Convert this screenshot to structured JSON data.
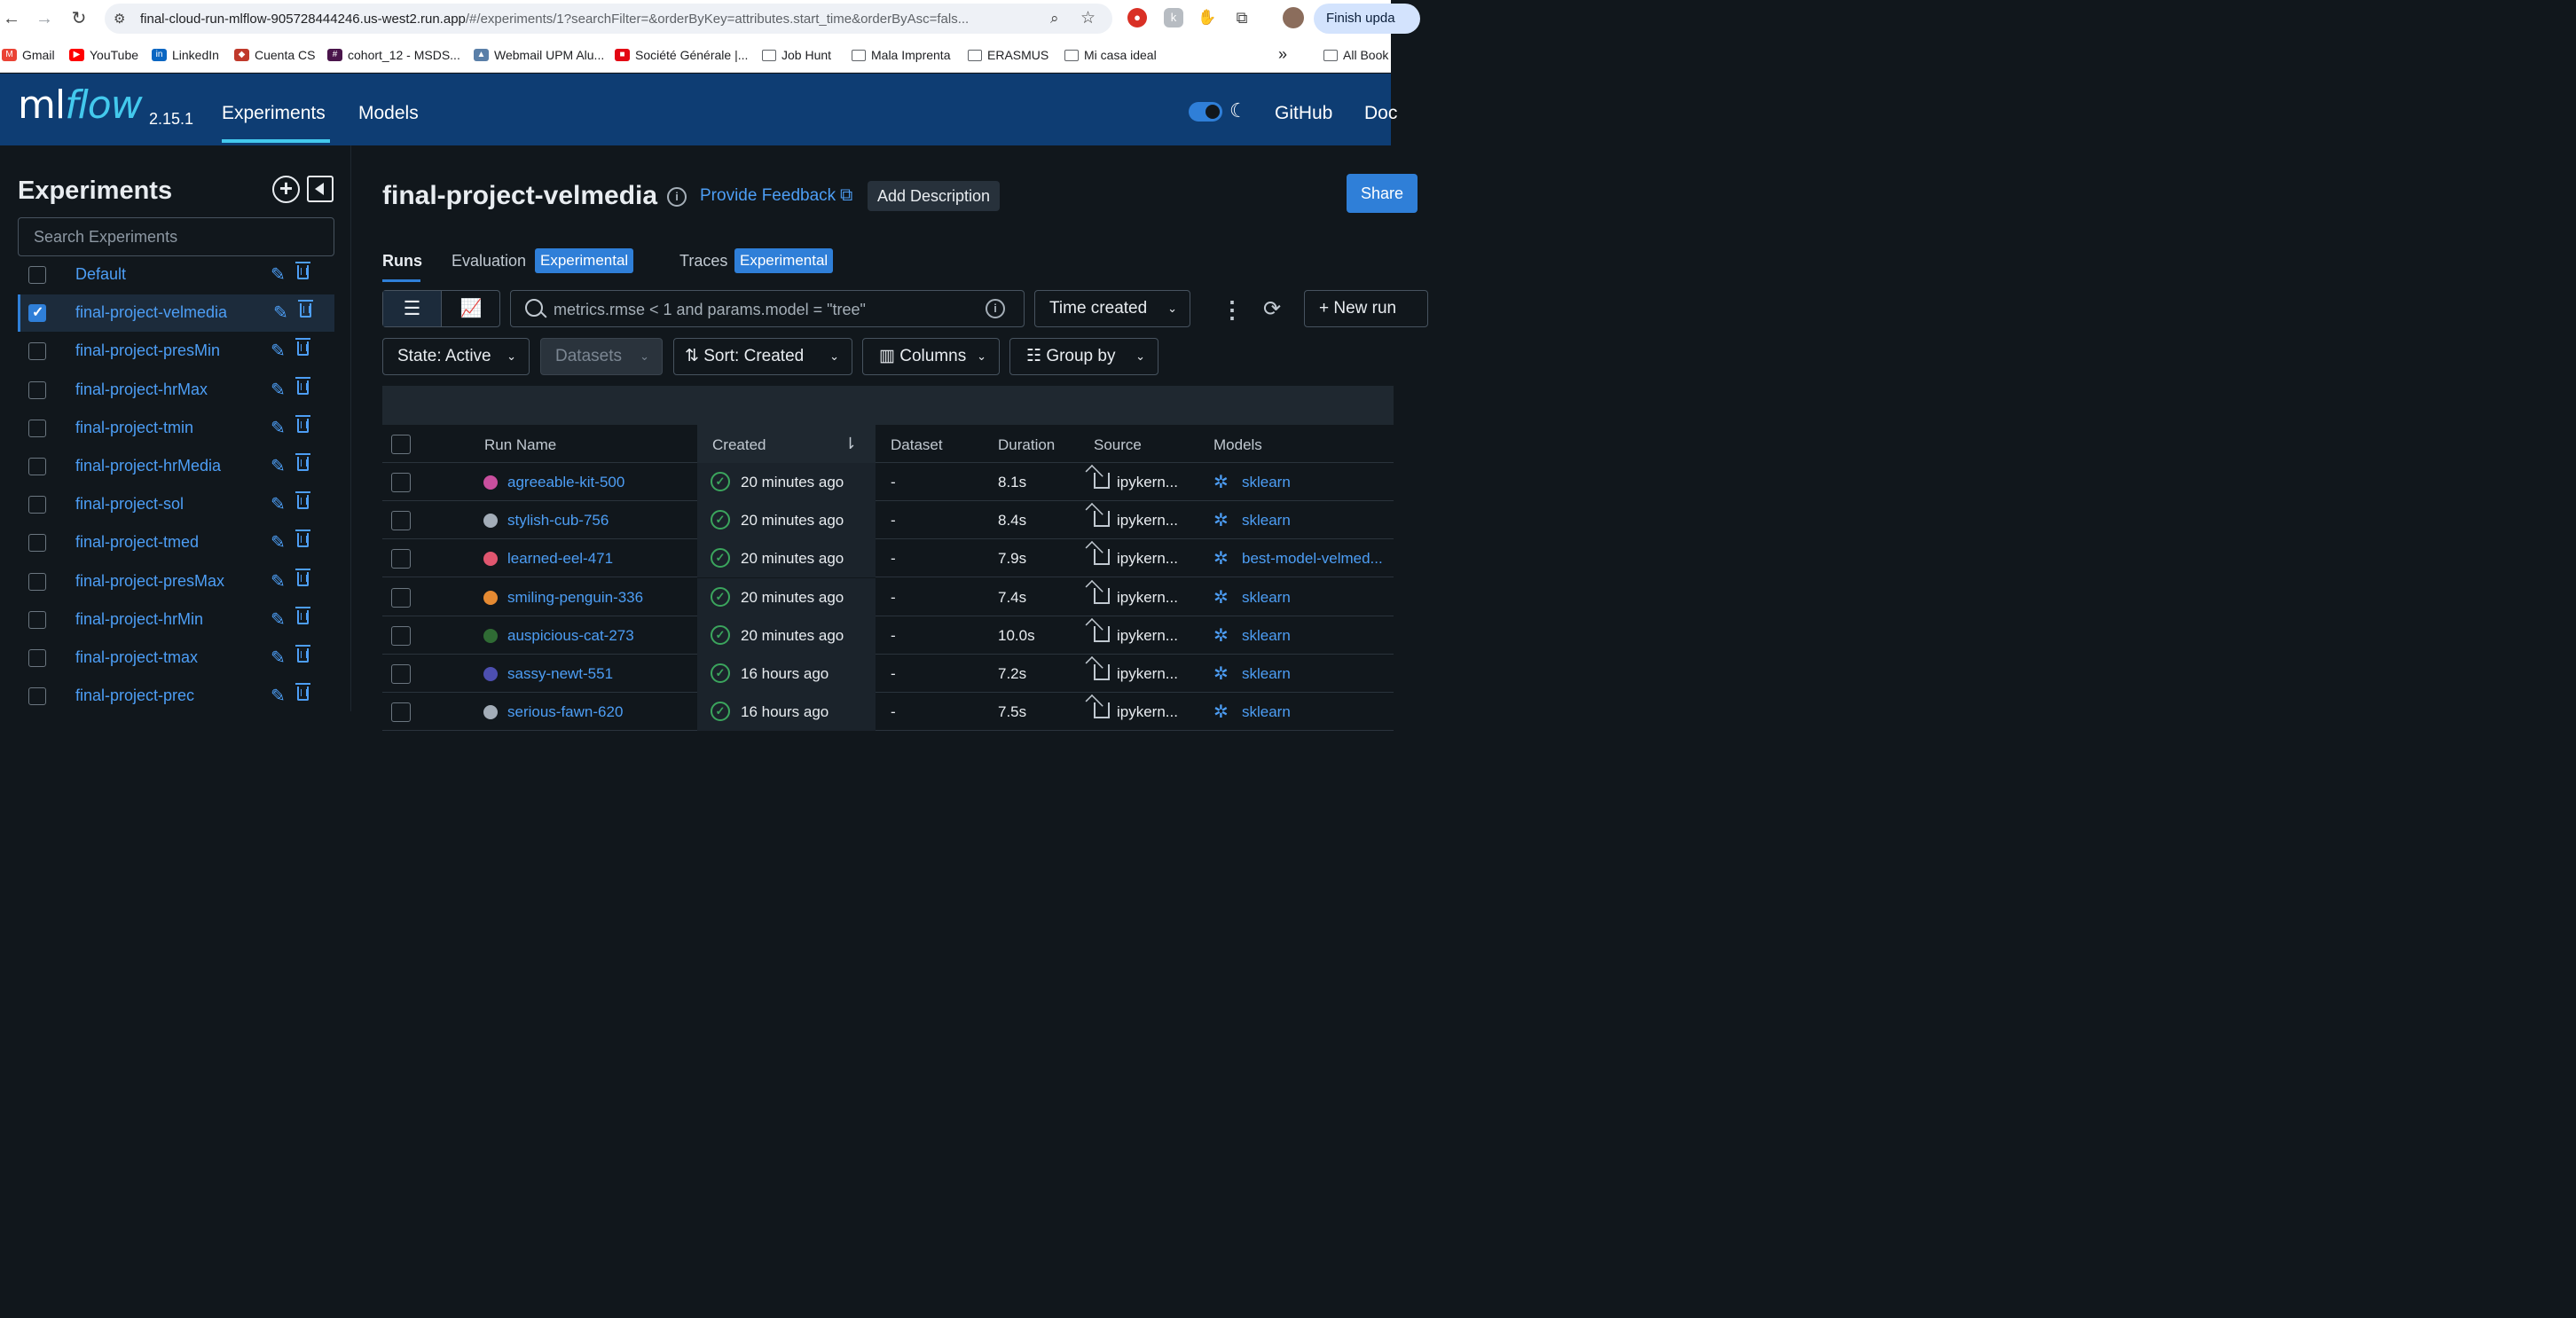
{
  "browser": {
    "url_main": "final-cloud-run-mlflow-905728444246.us-west2.run.app",
    "url_rest": "/#/experiments/1?searchFilter=&orderByKey=attributes.start_time&orderByAsc=fals...",
    "finish_update": "Finish upda",
    "bookmarks": [
      "Gmail",
      "YouTube",
      "LinkedIn",
      "Cuenta CS",
      "cohort_12 - MSDS...",
      "Webmail UPM Alu...",
      "Société Générale |...",
      "Job Hunt",
      "Mala Imprenta",
      "ERASMUS",
      "Mi casa ideal",
      "All Book"
    ],
    "overflow": "»"
  },
  "header": {
    "logo_ml": "ml",
    "logo_flow": "flow",
    "version": "2.15.1",
    "nav": [
      "Experiments",
      "Models"
    ],
    "github": "GitHub",
    "docs": "Doc"
  },
  "sidebar": {
    "title": "Experiments",
    "search_placeholder": "Search Experiments",
    "experiments": [
      {
        "name": "Default",
        "selected": false
      },
      {
        "name": "final-project-velmedia",
        "selected": true
      },
      {
        "name": "final-project-presMin",
        "selected": false
      },
      {
        "name": "final-project-hrMax",
        "selected": false
      },
      {
        "name": "final-project-tmin",
        "selected": false
      },
      {
        "name": "final-project-hrMedia",
        "selected": false
      },
      {
        "name": "final-project-sol",
        "selected": false
      },
      {
        "name": "final-project-tmed",
        "selected": false
      },
      {
        "name": "final-project-presMax",
        "selected": false
      },
      {
        "name": "final-project-hrMin",
        "selected": false
      },
      {
        "name": "final-project-tmax",
        "selected": false
      },
      {
        "name": "final-project-prec",
        "selected": false
      }
    ]
  },
  "main": {
    "title": "final-project-velmedia",
    "feedback": "Provide Feedback",
    "add_description": "Add Description",
    "share": "Share",
    "tabs": [
      {
        "label": "Runs",
        "badge": ""
      },
      {
        "label": "Evaluation",
        "badge": "Experimental"
      },
      {
        "label": "Traces",
        "badge": "Experimental"
      }
    ],
    "search_placeholder": "metrics.rmse < 1 and params.model = \"tree\"",
    "time_created": "Time created",
    "new_run": "New run",
    "filters": {
      "state": "State: Active",
      "datasets": "Datasets",
      "sort": "Sort: Created",
      "columns": "Columns",
      "group_by": "Group by"
    },
    "columns": [
      "Run Name",
      "Created",
      "Dataset",
      "Duration",
      "Source",
      "Models"
    ],
    "rows": [
      {
        "name": "agreeable-kit-500",
        "color": "#c94f9e",
        "created": "20 minutes ago",
        "dataset": "-",
        "duration": "8.1s",
        "source": "ipykern...",
        "model": "sklearn"
      },
      {
        "name": "stylish-cub-756",
        "color": "#a3adb8",
        "created": "20 minutes ago",
        "dataset": "-",
        "duration": "8.4s",
        "source": "ipykern...",
        "model": "sklearn"
      },
      {
        "name": "learned-eel-471",
        "color": "#e0566f",
        "created": "20 minutes ago",
        "dataset": "-",
        "duration": "7.9s",
        "source": "ipykern...",
        "model": "best-model-velmed..."
      },
      {
        "name": "smiling-penguin-336",
        "color": "#e58a32",
        "created": "20 minutes ago",
        "dataset": "-",
        "duration": "7.4s",
        "source": "ipykern...",
        "model": "sklearn"
      },
      {
        "name": "auspicious-cat-273",
        "color": "#2f6b34",
        "created": "20 minutes ago",
        "dataset": "-",
        "duration": "10.0s",
        "source": "ipykern...",
        "model": "sklearn"
      },
      {
        "name": "sassy-newt-551",
        "color": "#4d4fb0",
        "created": "16 hours ago",
        "dataset": "-",
        "duration": "7.2s",
        "source": "ipykern...",
        "model": "sklearn"
      },
      {
        "name": "serious-fawn-620",
        "color": "#a3adb8",
        "created": "16 hours ago",
        "dataset": "-",
        "duration": "7.5s",
        "source": "ipykern...",
        "model": "sklearn"
      }
    ]
  }
}
